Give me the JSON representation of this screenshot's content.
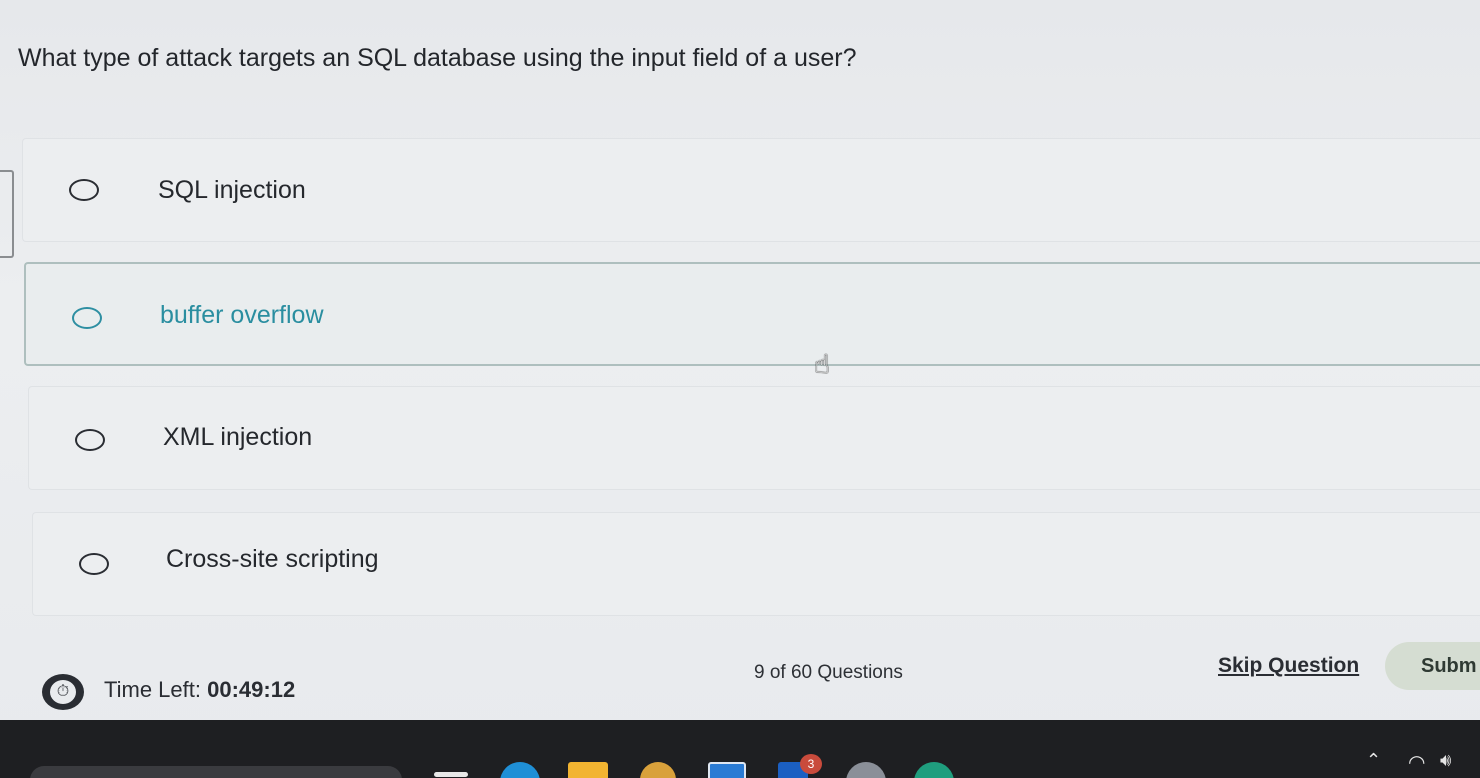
{
  "question": {
    "text": "What type of attack targets an SQL database using the input field of a user?"
  },
  "options": [
    {
      "label": "SQL injection",
      "selected": false
    },
    {
      "label": "buffer overflow",
      "selected": true
    },
    {
      "label": "XML injection",
      "selected": false
    },
    {
      "label": "Cross-site scripting",
      "selected": false
    }
  ],
  "footer": {
    "timer_prefix": "Time Left:",
    "timer_value": "00:49:12",
    "progress": "9 of 60 Questions",
    "skip_label": "Skip Question",
    "submit_label": "Subm"
  },
  "taskbar": {
    "notification_count": "3"
  },
  "icons": {
    "timer": "stopwatch-icon",
    "cursor": "hand-pointer-icon",
    "wifi": "wifi-icon",
    "volume": "volume-icon",
    "chevron": "chevron-up-icon"
  },
  "colors": {
    "selected_accent": "#2a8ea0",
    "submit_bg": "#d5ddd2",
    "taskbar_bg": "#1e1f22"
  }
}
